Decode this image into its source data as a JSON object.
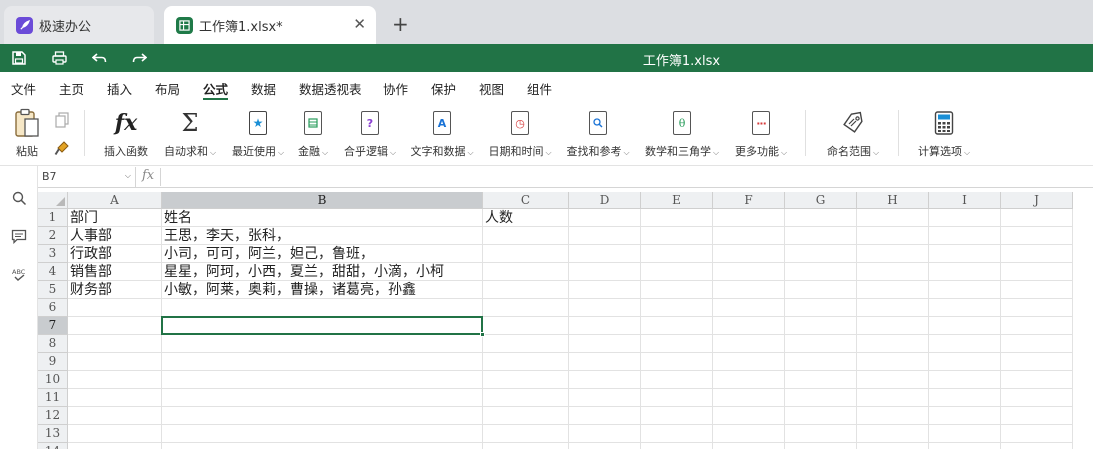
{
  "tabs": [
    {
      "label": "极速办公",
      "icon": "rocket-icon"
    },
    {
      "label": "工作簿1.xlsx*",
      "icon": "spreadsheet-icon"
    }
  ],
  "title_bar": {
    "title": "工作簿1.xlsx"
  },
  "menu": [
    "文件",
    "主页",
    "插入",
    "布局",
    "公式",
    "数据",
    "数据透视表",
    "协作",
    "保护",
    "视图",
    "组件"
  ],
  "menu_active": "公式",
  "ribbon": {
    "paste": "粘贴",
    "insert_function": "插入函数",
    "autosum": "自动求和",
    "recent": "最近使用",
    "finance": "金融",
    "logic": "合乎逻辑",
    "text_data": "文字和数据",
    "datetime": "日期和时间",
    "lookup": "查找和参考",
    "math": "数学和三角学",
    "more": "更多功能",
    "named_range": "命名范围",
    "calc_options": "计算选项"
  },
  "formula_bar": {
    "name_box": "B7",
    "fx": "fx",
    "formula": ""
  },
  "columns": [
    "A",
    "B",
    "C",
    "D",
    "E",
    "F",
    "G",
    "H",
    "I",
    "J"
  ],
  "rows": [
    "1",
    "2",
    "3",
    "4",
    "5",
    "6",
    "7",
    "8",
    "9",
    "10",
    "11",
    "12",
    "13",
    "14"
  ],
  "cells": {
    "A1": "部门",
    "B1": "姓名",
    "C1": "人数",
    "A2": "人事部",
    "B2": "王思，李天，张科，",
    "A3": "行政部",
    "B3": "小司，可可，阿兰，妲己，鲁班，",
    "A4": "销售部",
    "B4": "星星，阿珂，小西，夏兰，甜甜，小滴，小柯",
    "A5": "财务部",
    "B5": "小敏，阿莱，奥莉，曹操，诸葛亮，孙鑫"
  },
  "selected_cell": "B7",
  "colors": {
    "accent": "#217346",
    "header_bg": "#eef0f2",
    "header_selected": "#c9cccf"
  }
}
